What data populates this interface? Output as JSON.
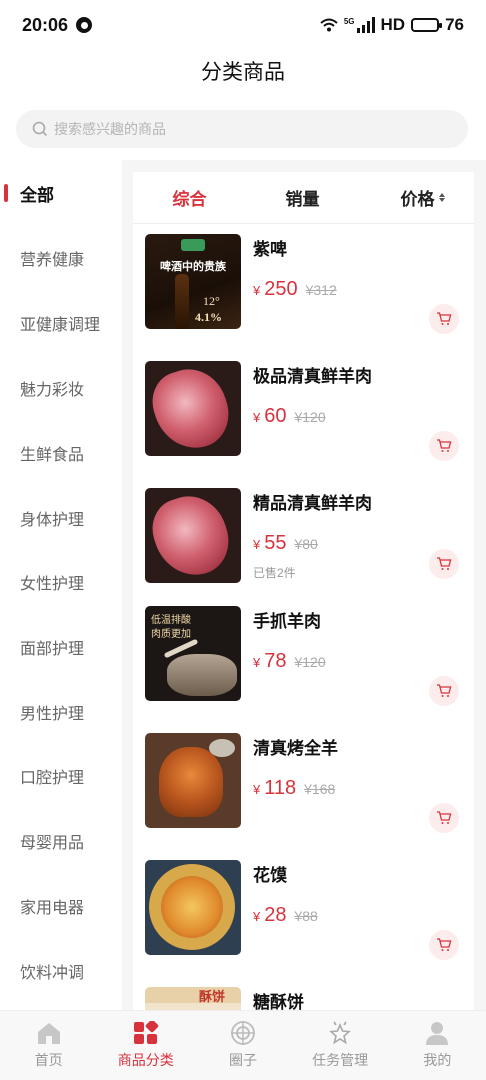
{
  "status_bar": {
    "time": "20:06",
    "network": "5G",
    "hd": "HD",
    "battery": "76",
    "battery_level": 0.76
  },
  "page_title": "分类商品",
  "search": {
    "placeholder": "搜索感兴趣的商品"
  },
  "sidebar": {
    "items": [
      {
        "label": "全部",
        "active": true
      },
      {
        "label": "营养健康"
      },
      {
        "label": "亚健康调理"
      },
      {
        "label": "魅力彩妆"
      },
      {
        "label": "生鲜食品"
      },
      {
        "label": "身体护理"
      },
      {
        "label": "女性护理"
      },
      {
        "label": "面部护理"
      },
      {
        "label": "男性护理"
      },
      {
        "label": "口腔护理"
      },
      {
        "label": "母婴用品"
      },
      {
        "label": "家用电器"
      },
      {
        "label": "饮料冲调"
      }
    ]
  },
  "sort_tabs": [
    {
      "label": "综合",
      "active": true
    },
    {
      "label": "销量"
    },
    {
      "label": "价格"
    }
  ],
  "currency_symbol": "¥",
  "products": [
    {
      "name": "紫啤",
      "price": "250",
      "old_price": "¥312",
      "image": {
        "line1": "啤酒中的贵族",
        "line2": "12°",
        "line3": "4.1%"
      }
    },
    {
      "name": "极品清真鲜羊肉",
      "price": "60",
      "old_price": "¥120"
    },
    {
      "name": "精品清真鲜羊肉",
      "price": "55",
      "old_price": "¥80",
      "sold": "已售2件"
    },
    {
      "name": "手抓羊肉",
      "price": "78",
      "old_price": "¥120",
      "image": {
        "line1": "低温排酸",
        "line2": "肉质更加"
      }
    },
    {
      "name": "清真烤全羊",
      "price": "118",
      "old_price": "¥168"
    },
    {
      "name": "花馍",
      "price": "28",
      "old_price": "¥88"
    },
    {
      "name": "糖酥饼",
      "image": {
        "line1": "酥饼"
      }
    }
  ],
  "tab_bar": [
    {
      "label": "首页",
      "icon": "home-icon"
    },
    {
      "label": "商品分类",
      "icon": "category-icon",
      "active": true
    },
    {
      "label": "圈子",
      "icon": "circle-target-icon"
    },
    {
      "label": "任务管理",
      "icon": "task-star-icon"
    },
    {
      "label": "我的",
      "icon": "profile-icon"
    }
  ],
  "colors": {
    "accent": "#d8333d",
    "cart_bg": "#fdecec",
    "panel_bg": "#f5f5f5"
  }
}
